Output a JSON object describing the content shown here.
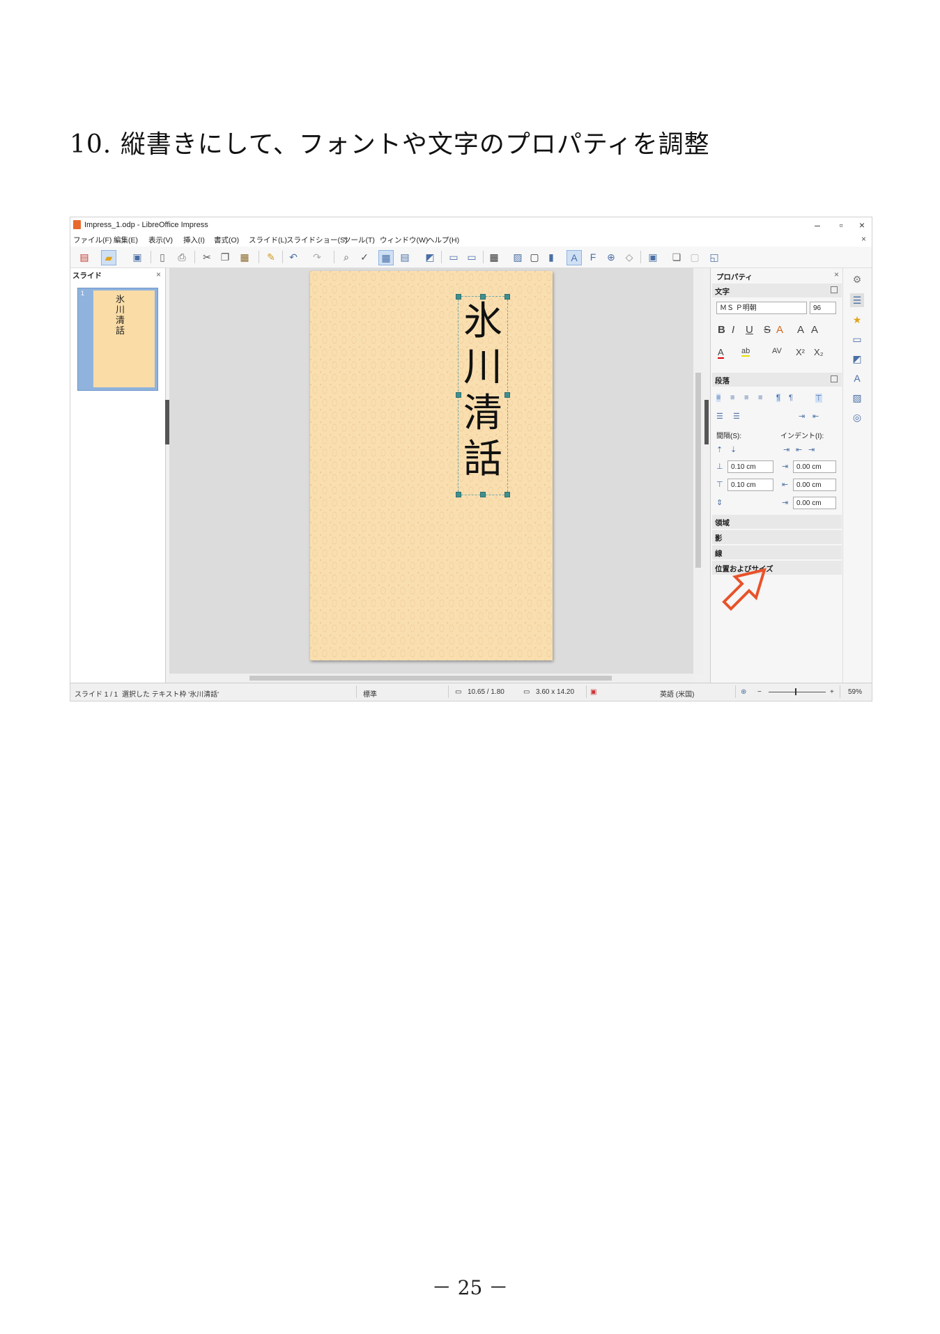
{
  "document": {
    "heading": "10. 縦書きにして、フォントや文字のプロパティを調整",
    "page_number": "－ 25 －"
  },
  "window": {
    "title": "Impress_1.odp - LibreOffice Impress",
    "controls": [
      "–",
      "▫",
      "×"
    ]
  },
  "menu": {
    "items": [
      "ファイル(F)",
      "編集(E)",
      "表示(V)",
      "挿入(I)",
      "書式(O)",
      "スライド(L)",
      "スライドショー(S)",
      "ツール(T)",
      "ウィンドウ(W)",
      "ヘルプ(H)"
    ],
    "close": "×"
  },
  "slides_panel": {
    "title": "スライド",
    "close": "×",
    "thumb_number": "1",
    "thumb_text": "氷川清話"
  },
  "slide": {
    "text": "氷川清話"
  },
  "properties": {
    "title": "プロパティ",
    "close": "×",
    "char_section": "文字",
    "font_name": "ＭＳ Ｐ明朝",
    "font_size": "96",
    "format_buttons": [
      "B",
      "I",
      "U",
      "S",
      "A",
      "A",
      "A"
    ],
    "color_buttons": [
      "A",
      "ab",
      "AV",
      "X²",
      "X₂"
    ],
    "para_section": "段落",
    "spacing_label": "間隔(S):",
    "indent_label": "インデント(I):",
    "above_spacing": "0.10 cm",
    "below_spacing": "0.10 cm",
    "indent_before": "0.00 cm",
    "indent_after": "0.00 cm",
    "indent_first": "0.00 cm",
    "collapsed_sections": [
      "領域",
      "影",
      "線",
      "位置およびサイズ"
    ]
  },
  "status": {
    "slide": "スライド 1 / 1",
    "selection": "選択した テキスト枠 '氷川清話'",
    "layout": "標準",
    "position": "10.65 / 1.80",
    "size": "3.60 x 14.20",
    "language": "英語 (米国)",
    "zoom_minus": "−",
    "zoom_plus": "+",
    "zoom": "59%"
  },
  "colors": {
    "accent": "#4a6fa5",
    "arrow": "#e8522a",
    "slide_bg": "#f9dfb0"
  }
}
